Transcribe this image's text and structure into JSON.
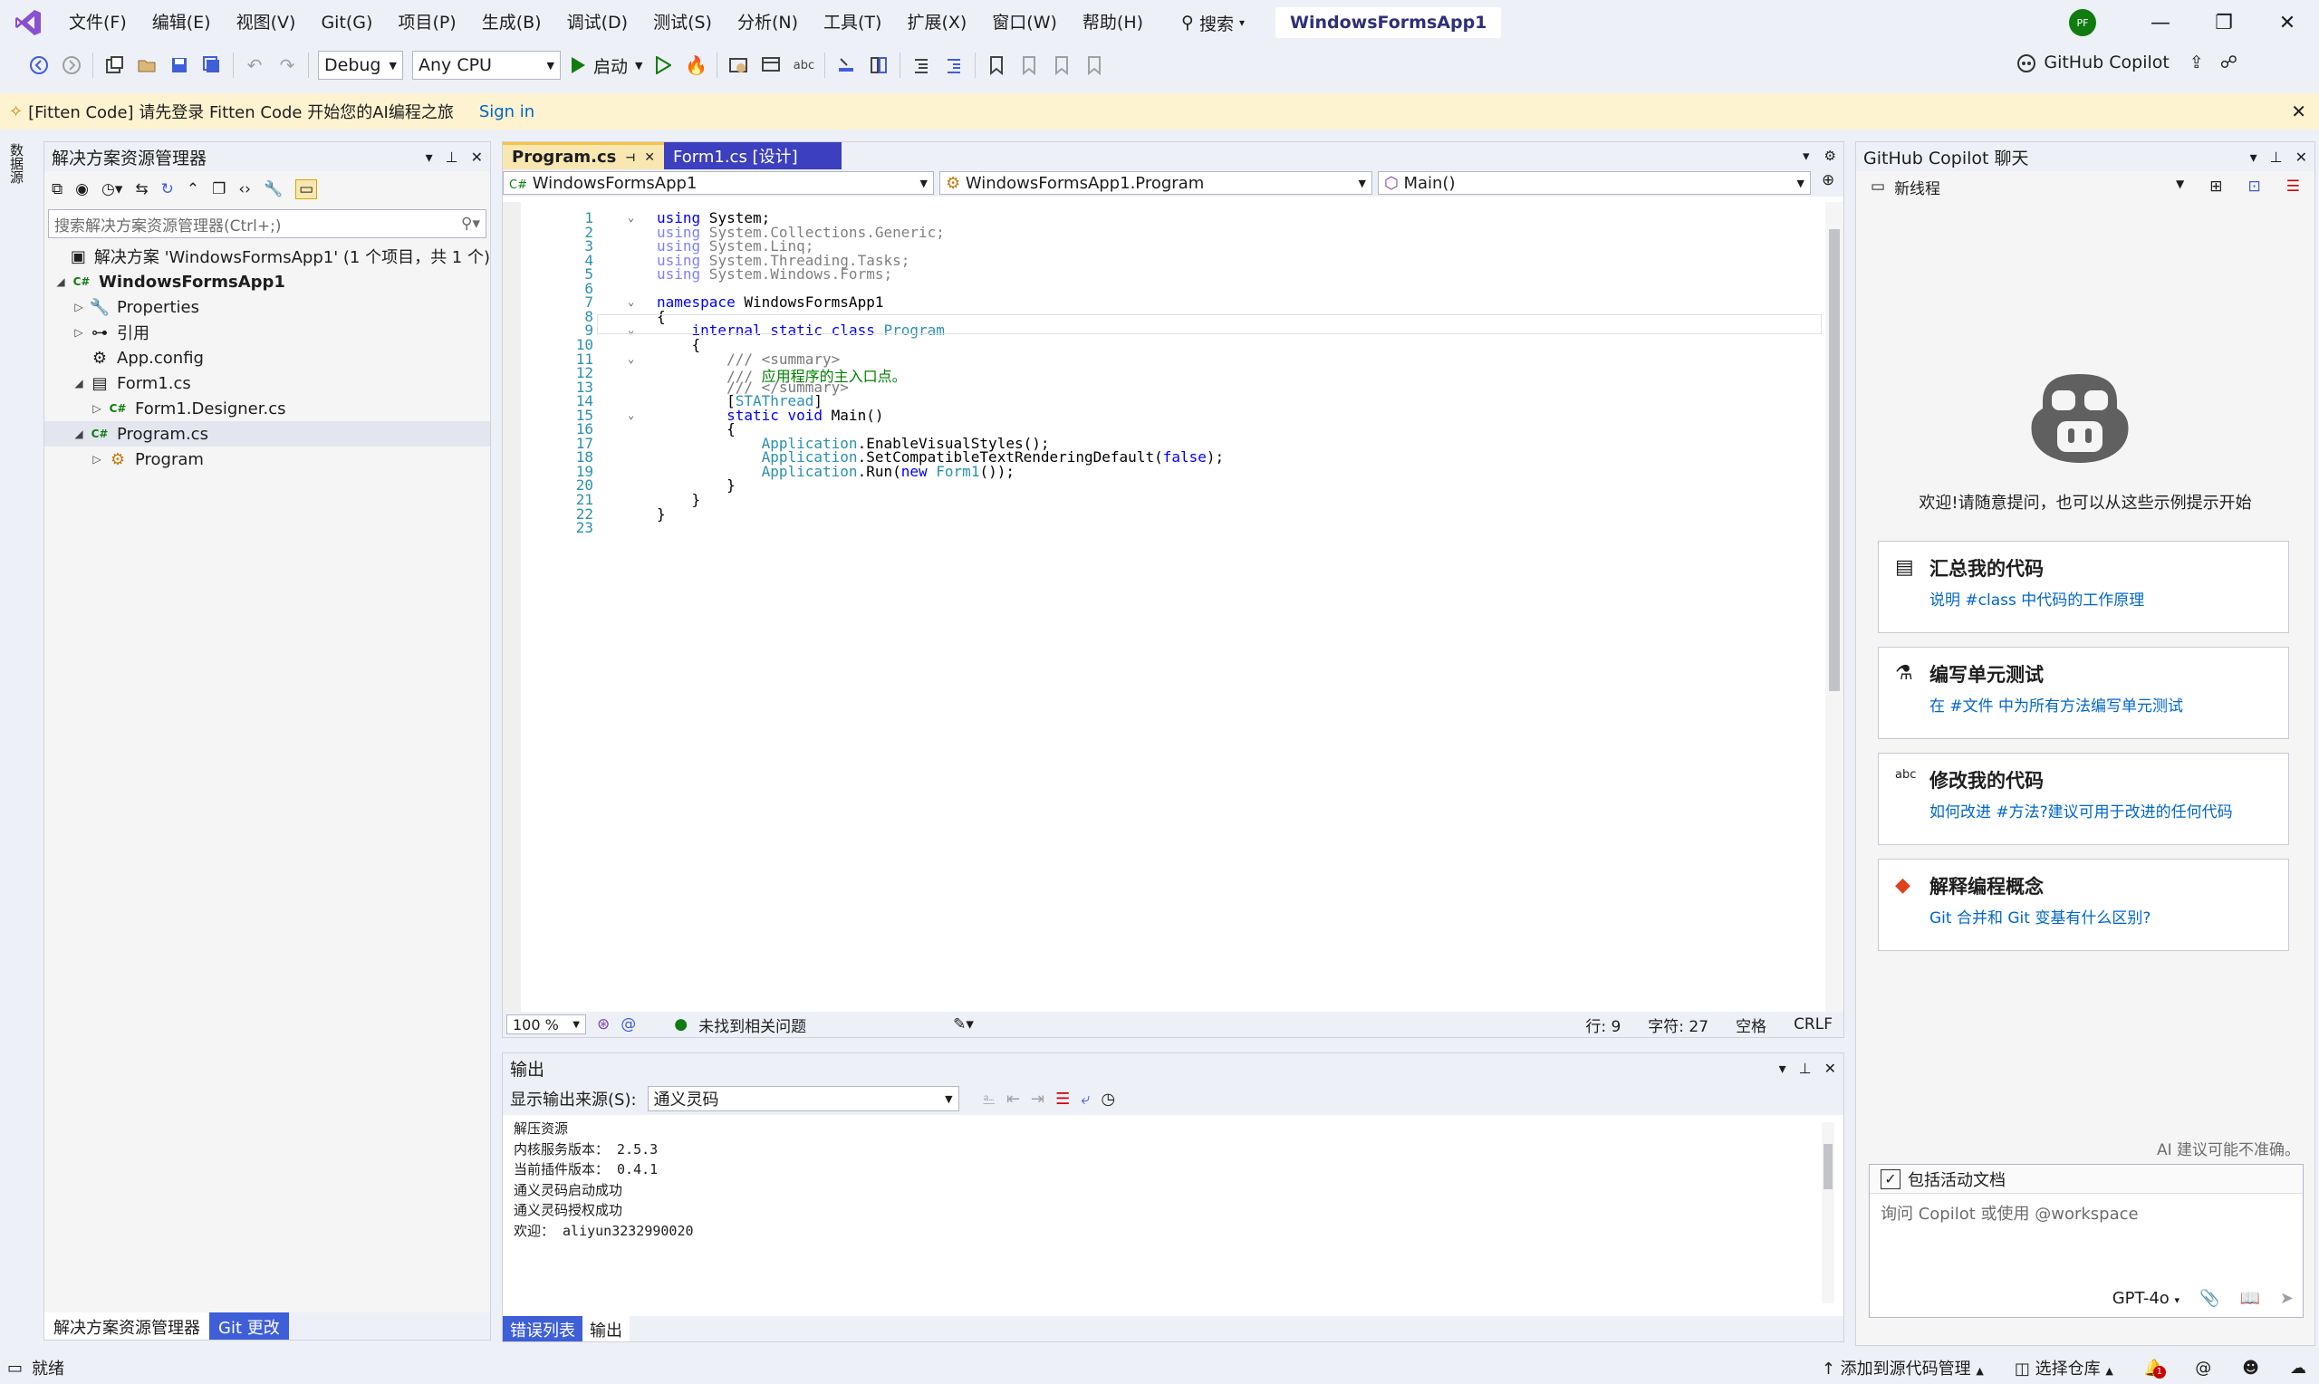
{
  "menu": [
    "文件(F)",
    "编辑(E)",
    "视图(V)",
    "Git(G)",
    "项目(P)",
    "生成(B)",
    "调试(D)",
    "测试(S)",
    "分析(N)",
    "工具(T)",
    "扩展(X)",
    "窗口(W)",
    "帮助(H)"
  ],
  "search_label": "搜索",
  "solution_title": "WindowsFormsApp1",
  "avatar_initials": "PF",
  "toolbar": {
    "config": "Debug",
    "platform": "Any CPU",
    "start": "启动",
    "copilot": "GitHub Copilot"
  },
  "infobar": {
    "message": "[Fitten Code] 请先登录 Fitten Code 开始您的AI编程之旅",
    "signin": "Sign in"
  },
  "leftstrip": {
    "label": "数据源"
  },
  "solexp": {
    "title": "解决方案资源管理器",
    "search_placeholder": "搜索解决方案资源管理器(Ctrl+;)",
    "tree": [
      {
        "label": "解决方案 'WindowsFormsApp1' (1 个项目，共 1 个)",
        "arrow": "",
        "icon": "solution-icon",
        "bold": false
      },
      {
        "label": "WindowsFormsApp1",
        "arrow": "◢",
        "icon": "csharp-project-icon",
        "bold": true
      },
      {
        "label": "Properties",
        "arrow": "▷",
        "icon": "wrench-icon",
        "bold": false
      },
      {
        "label": "引用",
        "arrow": "▷",
        "icon": "references-icon",
        "bold": false
      },
      {
        "label": "App.config",
        "arrow": "",
        "icon": "config-file-icon",
        "bold": false
      },
      {
        "label": "Form1.cs",
        "arrow": "◢",
        "icon": "form-icon",
        "bold": false
      },
      {
        "label": "Form1.Designer.cs",
        "arrow": "▷",
        "icon": "csharp-file-icon",
        "bold": false
      },
      {
        "label": "Program.cs",
        "arrow": "◢",
        "icon": "csharp-file-icon",
        "bold": false
      },
      {
        "label": "Program",
        "arrow": "▷",
        "icon": "class-icon",
        "bold": false
      }
    ],
    "tabs": [
      "解决方案资源管理器",
      "Git 更改"
    ]
  },
  "editor": {
    "tabs": [
      "Program.cs",
      "Form1.cs [设计]"
    ],
    "nav": [
      "WindowsFormsApp1",
      "WindowsFormsApp1.Program",
      "Main()"
    ],
    "zoom": "100 %",
    "issues": "未找到相关问题",
    "line": "行: 9",
    "char": "字符: 27",
    "spacing": "空格",
    "eol": "CRLF",
    "lines": [
      "using System;",
      "using System.Collections.Generic;",
      "using System.Linq;",
      "using System.Threading.Tasks;",
      "using System.Windows.Forms;",
      "",
      "namespace WindowsFormsApp1",
      "{",
      "    internal static class Program",
      "    {",
      "        /// <summary>",
      "        /// 应用程序的主入口点。",
      "        /// </summary>",
      "        [STAThread]",
      "        static void Main()",
      "        {",
      "            Application.EnableVisualStyles();",
      "            Application.SetCompatibleTextRenderingDefault(false);",
      "            Application.Run(new Form1());",
      "        }",
      "    }",
      "}",
      ""
    ]
  },
  "output": {
    "title": "输出",
    "source_label": "显示输出来源(S):",
    "source": "通义灵码",
    "text": "解压资源\n内核服务版本： 2.5.3\n当前插件版本： 0.4.1\n通义灵码启动成功\n通义灵码授权成功\n欢迎： aliyun3232990020",
    "tabs": [
      "错误列表",
      "输出"
    ]
  },
  "copilot": {
    "title": "GitHub Copilot 聊天",
    "thread": "新线程",
    "welcome": "欢迎!请随意提问，也可以从这些示例提示开始",
    "cards": [
      {
        "title": "汇总我的代码",
        "sub": "说明 #class 中代码的工作原理",
        "icon": "summarize-icon"
      },
      {
        "title": "编写单元测试",
        "sub": "在 #文件 中为所有方法编写单元测试",
        "icon": "flask-icon"
      },
      {
        "title": "修改我的代码",
        "sub": "如何改进 #方法?建议可用于改进的任何代码",
        "icon": "spellcheck-icon"
      },
      {
        "title": "解释编程概念",
        "sub": "Git 合并和 Git 变基有什么区别?",
        "icon": "git-icon"
      }
    ],
    "note": "AI 建议可能不准确。",
    "include_doc": "包括活动文档",
    "input_placeholder": "询问 Copilot 或使用 @workspace",
    "model": "GPT-4o"
  },
  "status": {
    "ready": "就绪",
    "add_source": "添加到源代码管理",
    "select_repo": "选择仓库",
    "notif_count": "1"
  },
  "colors": {
    "accent": "#3f5fd8",
    "keyword": "#0000ff",
    "type": "#2b91af",
    "comment": "#008000"
  }
}
